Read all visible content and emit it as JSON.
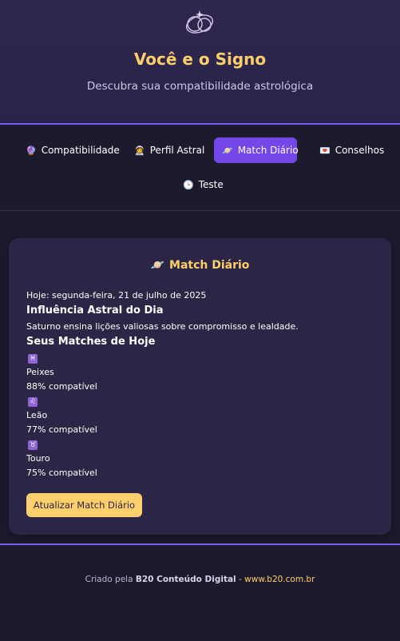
{
  "header": {
    "title": "Você e o Signo",
    "subtitle": "Descubra sua compatibilidade astrológica",
    "logo_icon": "crystal-planets-icon"
  },
  "nav": {
    "tabs": [
      {
        "icon": "🔮",
        "label": "Compatibilidade",
        "active": false
      },
      {
        "icon": "🧑‍🚀",
        "label": "Perfil Astral",
        "active": false
      },
      {
        "icon": "🪐",
        "label": "Match Diário",
        "active": true
      },
      {
        "icon": "💌",
        "label": "Conselhos",
        "active": false
      },
      {
        "icon": "🕒",
        "label": "Teste",
        "active": false
      }
    ]
  },
  "card": {
    "title_icon": "🪐",
    "title": "Match Diário",
    "date_line": "Hoje: segunda-feira, 21 de julho de 2025",
    "influence_heading": "Influência Astral do Dia",
    "influence_text": "Saturno ensina lições valiosas sobre compromisso e lealdade.",
    "matches_heading": "Seus Matches de Hoje",
    "matches": [
      {
        "symbol": "♓",
        "sign": "Peixes",
        "compat": "88% compatível"
      },
      {
        "symbol": "♌",
        "sign": "Leão",
        "compat": "77% compatível"
      },
      {
        "symbol": "♉",
        "sign": "Touro",
        "compat": "75% compatível"
      }
    ],
    "refresh_label": "Atualizar Match Diário"
  },
  "footer": {
    "prefix": "Criado pela ",
    "brand": "B20 Conteúdo Digital",
    "separator": " - ",
    "link": "www.b20.com.br"
  },
  "colors": {
    "accent": "#7547e8",
    "gold": "#ffcf6b",
    "background": "#1e1a2e",
    "card": "#2c2545"
  }
}
